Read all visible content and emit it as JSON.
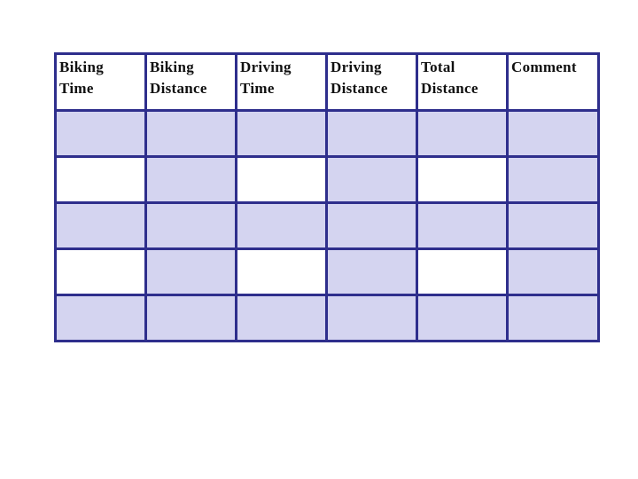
{
  "table": {
    "headers": [
      [
        "Biking",
        "Time"
      ],
      [
        "Biking",
        "Distance"
      ],
      [
        "Driving",
        "Time"
      ],
      [
        "Driving",
        "Distance"
      ],
      [
        "Total",
        "Distance"
      ],
      [
        "Comment",
        ""
      ]
    ],
    "rows": [
      [
        "",
        "",
        "",
        "",
        "",
        ""
      ],
      [
        "",
        "",
        "",
        "",
        "",
        ""
      ],
      [
        "",
        "",
        "",
        "",
        "",
        ""
      ],
      [
        "",
        "",
        "",
        "",
        "",
        ""
      ],
      [
        "",
        "",
        "",
        "",
        "",
        ""
      ]
    ],
    "colors": {
      "border": "#2e2e8c",
      "shaded": "#d4d4f0",
      "plain": "#ffffff"
    }
  }
}
